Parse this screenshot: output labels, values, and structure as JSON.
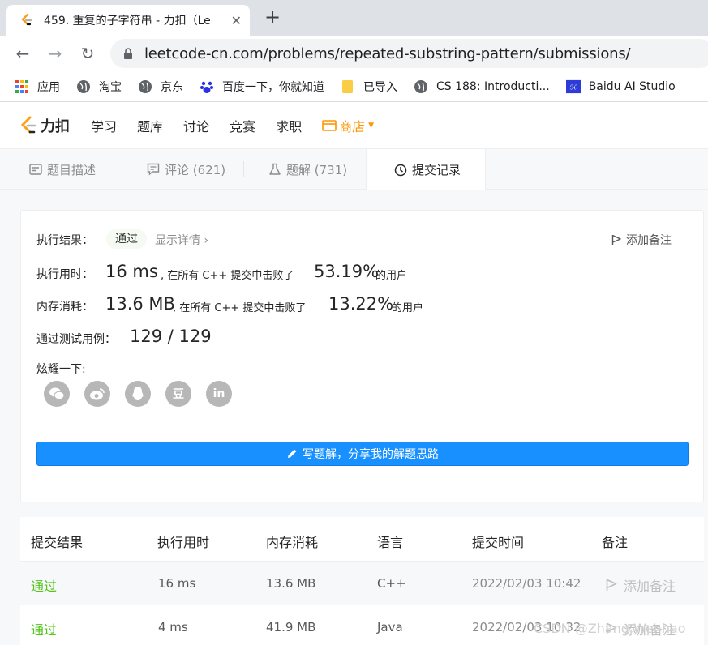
{
  "browser": {
    "tab_title": "459. 重复的子字符串 - 力扣（Le",
    "url": "leetcode-cn.com/problems/repeated-substring-pattern/submissions/",
    "bookmarks": [
      {
        "label": "应用",
        "icon": "apps-grid-icon"
      },
      {
        "label": "淘宝",
        "icon": "globe-icon"
      },
      {
        "label": "京东",
        "icon": "globe-icon"
      },
      {
        "label": "百度一下，你就知道",
        "icon": "baidu-paw-icon"
      },
      {
        "label": "已导入",
        "icon": "folder-icon"
      },
      {
        "label": "CS 188: Introducti...",
        "icon": "globe-icon"
      },
      {
        "label": "Baidu AI Studio",
        "icon": "ai-studio-icon"
      }
    ]
  },
  "site": {
    "logo_text": "力扣",
    "nav": [
      "学习",
      "题库",
      "讨论",
      "竞赛",
      "求职"
    ],
    "store": "商店",
    "accent": "#ff9500"
  },
  "problem_tabs": [
    {
      "label": "题目描述",
      "icon": "description-icon"
    },
    {
      "label": "评论 (621)",
      "icon": "comment-icon"
    },
    {
      "label": "题解 (731)",
      "icon": "flask-icon"
    },
    {
      "label": "提交记录",
      "icon": "clock-icon"
    }
  ],
  "result": {
    "status_label": "执行结果：",
    "status": "通过",
    "detail_link": "显示详情 ›",
    "add_note": "添加备注",
    "runtime_label": "执行用时：",
    "runtime_value": "16 ms",
    "runtime_mid": ", 在所有 C++ 提交中击败了",
    "runtime_percent": "53.19%",
    "runtime_tail": "的用户",
    "memory_label": "内存消耗：",
    "memory_value": "13.6 MB",
    "memory_mid": ", 在所有 C++ 提交中击败了",
    "memory_percent": "13.22%",
    "memory_tail": "的用户",
    "tests_label": "通过测试用例：",
    "tests_value": "129 / 129",
    "share_label": "炫耀一下:",
    "share_icons": [
      "wechat-icon",
      "weibo-icon",
      "qq-icon",
      "douban-icon",
      "linkedin-icon"
    ],
    "douban_glyph": "豆",
    "linkedin_glyph": "in",
    "write_button": "写题解，分享我的解题思路",
    "button_color": "#1890ff"
  },
  "submissions": {
    "headers": [
      "提交结果",
      "执行用时",
      "内存消耗",
      "语言",
      "提交时间",
      "备注"
    ],
    "rows": [
      {
        "result": "通过",
        "runtime": "16 ms",
        "memory": "13.6 MB",
        "lang": "C++",
        "time": "2022/02/03 10:42",
        "note": "添加备注"
      },
      {
        "result": "通过",
        "runtime": "4 ms",
        "memory": "41.9 MB",
        "lang": "Java",
        "time": "2022/02/03 10:32",
        "note": "添加备注"
      }
    ],
    "success_color": "#52c41a"
  },
  "watermark": "CSDN @Zhang Wenhao"
}
